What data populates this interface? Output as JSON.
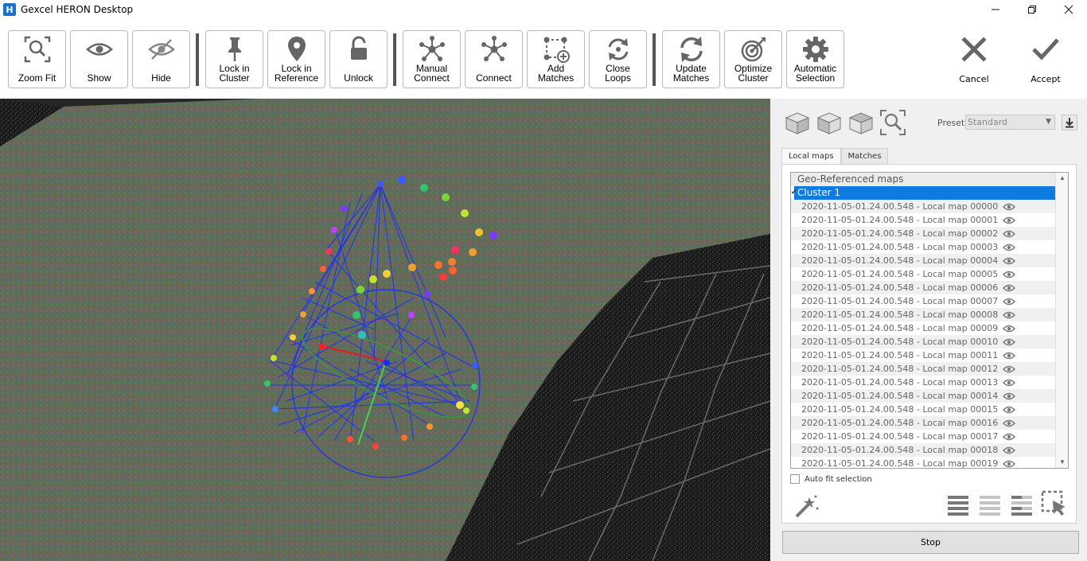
{
  "window": {
    "title": "Gexcel HERON Desktop",
    "icon_letter": "H",
    "controls": [
      "minimize",
      "restore",
      "close"
    ]
  },
  "toolbar": {
    "buttons": [
      {
        "id": "zoom-fit",
        "label": "Zoom Fit",
        "icon": "zoom-fit-icon"
      },
      {
        "id": "show",
        "label": "Show",
        "icon": "eye-icon"
      },
      {
        "id": "hide",
        "label": "Hide",
        "icon": "eye-off-icon"
      },
      {
        "id": "lock-in-cluster",
        "label": "Lock in\nCluster",
        "icon": "pin-icon"
      },
      {
        "id": "lock-in-reference",
        "label": "Lock in\nReference",
        "icon": "location-pin-icon"
      },
      {
        "id": "unlock",
        "label": "Unlock",
        "icon": "unlock-icon"
      },
      {
        "id": "manual-connect",
        "label": "Manual\nConnect",
        "icon": "hub-icon"
      },
      {
        "id": "connect",
        "label": "Connect",
        "icon": "hub-icon"
      },
      {
        "id": "add-matches",
        "label": "Add\nMatches",
        "icon": "add-nodes-icon"
      },
      {
        "id": "close-loops",
        "label": "Close\nLoops",
        "icon": "loop-icon"
      },
      {
        "id": "update-matches",
        "label": "Update\nMatches",
        "icon": "refresh-icon"
      },
      {
        "id": "optimize-cluster",
        "label": "Optimize\nCluster",
        "icon": "target-icon"
      },
      {
        "id": "automatic-selection",
        "label": "Automatic\nSelection",
        "icon": "gear-icon"
      }
    ],
    "cancel_label": "Cancel",
    "accept_label": "Accept"
  },
  "panel": {
    "preset_label": "Preset:",
    "preset_value": "Standard",
    "tabs": [
      {
        "label": "Local maps",
        "active": true
      },
      {
        "label": "Matches",
        "active": false
      }
    ],
    "tree": {
      "header": "Geo-Referenced maps",
      "cluster": "Cluster 1",
      "items": [
        "2020-11-05-01.24.00.548 - Local map 00000",
        "2020-11-05-01.24.00.548 - Local map 00001",
        "2020-11-05-01.24.00.548 - Local map 00002",
        "2020-11-05-01.24.00.548 - Local map 00003",
        "2020-11-05-01.24.00.548 - Local map 00004",
        "2020-11-05-01.24.00.548 - Local map 00005",
        "2020-11-05-01.24.00.548 - Local map 00006",
        "2020-11-05-01.24.00.548 - Local map 00007",
        "2020-11-05-01.24.00.548 - Local map 00008",
        "2020-11-05-01.24.00.548 - Local map 00009",
        "2020-11-05-01.24.00.548 - Local map 00010",
        "2020-11-05-01.24.00.548 - Local map 00011",
        "2020-11-05-01.24.00.548 - Local map 00012",
        "2020-11-05-01.24.00.548 - Local map 00013",
        "2020-11-05-01.24.00.548 - Local map 00014",
        "2020-11-05-01.24.00.548 - Local map 00015",
        "2020-11-05-01.24.00.548 - Local map 00016",
        "2020-11-05-01.24.00.548 - Local map 00017",
        "2020-11-05-01.24.00.548 - Local map 00018",
        "2020-11-05-01.24.00.548 - Local map 00019"
      ]
    },
    "autofit_label": "Auto fit selection",
    "stop_label": "Stop"
  },
  "colors": {
    "selection": "#0f7be0",
    "graph_edges": "#1a2bff",
    "background_dark": "#2a2a2a"
  }
}
